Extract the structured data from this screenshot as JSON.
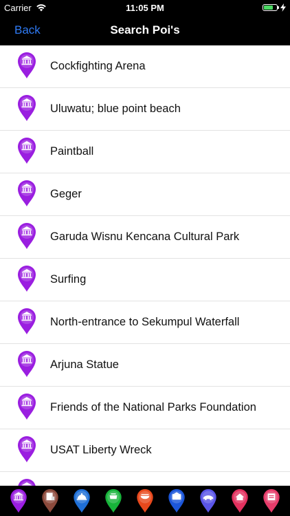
{
  "status_bar": {
    "carrier": "Carrier",
    "time": "11:05 PM",
    "battery_level": 0.7
  },
  "nav": {
    "back_label": "Back",
    "title": "Search Poi's"
  },
  "poi_pin_color": "#9a1ee0",
  "pois": [
    {
      "label": "Cockfighting Arena"
    },
    {
      "label": "Uluwatu; blue point beach"
    },
    {
      "label": "Paintball"
    },
    {
      "label": "Geger"
    },
    {
      "label": "Garuda Wisnu Kencana Cultural Park"
    },
    {
      "label": "Surfing"
    },
    {
      "label": "North-entrance to Sekumpul Waterfall"
    },
    {
      "label": "Arjuna Statue"
    },
    {
      "label": "Friends of the National Parks Foundation"
    },
    {
      "label": "USAT Liberty Wreck"
    },
    {
      "label": ""
    }
  ],
  "toolbar": [
    {
      "icon": "museum-pin-icon",
      "color": "#9a1ee0"
    },
    {
      "icon": "hotel-pin-icon",
      "color": "#8b4a3c"
    },
    {
      "icon": "service-pin-icon",
      "color": "#1f6fd6"
    },
    {
      "icon": "cafe-pin-icon",
      "color": "#17b33a"
    },
    {
      "icon": "restaurant-pin-icon",
      "color": "#e8481c"
    },
    {
      "icon": "atm-pin-icon",
      "color": "#1c56d9"
    },
    {
      "icon": "transport-pin-icon",
      "color": "#5a55e8"
    },
    {
      "icon": "home-pin-icon",
      "color": "#e2315e"
    },
    {
      "icon": "shop-pin-icon",
      "color": "#e63c6a"
    }
  ]
}
